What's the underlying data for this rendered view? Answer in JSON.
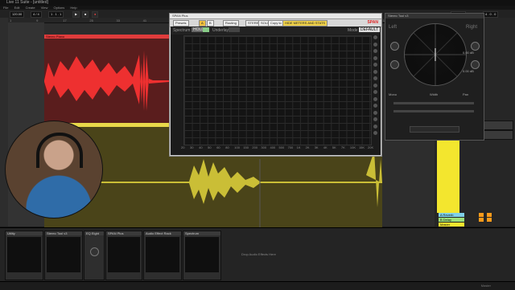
{
  "window": {
    "title": "Live 11 Suite - [untitled]"
  },
  "menu": [
    "File",
    "Edit",
    "Create",
    "View",
    "Options",
    "Help"
  ],
  "transport": {
    "tempo": "120.00",
    "signature": "4 / 4",
    "position": "1 . 1 . 1",
    "loop_start": "1 . 1 . 1",
    "loop_len": "4 . 0 . 0"
  },
  "ruler_marks": [
    "1",
    "9",
    "17",
    "25",
    "33",
    "41",
    "49",
    "57",
    "65",
    "73",
    "81",
    "89",
    "97",
    "105",
    "113",
    "121"
  ],
  "tracks": [
    {
      "name": "Stereo Piano",
      "color": "#e03c3c"
    },
    {
      "name": "Vocal Take",
      "color": "#e8d84a"
    }
  ],
  "right_tracks": [
    {
      "label": "A Reverb",
      "color": "#7fd0e8"
    },
    {
      "label": "B Delay",
      "color": "#9be07a"
    },
    {
      "label": "Master",
      "color": "#f3e62e"
    }
  ],
  "spectrum": {
    "window_title": "SPAN Plus",
    "toolbar": [
      "Presets",
      "A",
      "B",
      "Routing",
      "STEREO",
      "SOLO",
      "Copy to",
      "HIDE METERS AND STATS"
    ],
    "logo": "SPAN",
    "head_left": "Spectrum",
    "hold_label": "HOLD",
    "underlay_label": "Underlay",
    "mode_label": "Mode",
    "mode_value": "DEFAULT",
    "freq_labels": [
      "20",
      "30",
      "40",
      "50",
      "60",
      "80",
      "100",
      "150",
      "200",
      "300",
      "400",
      "500",
      "700",
      "1K",
      "2K",
      "3K",
      "4K",
      "5K",
      "7K",
      "10K",
      "15K",
      "20K"
    ]
  },
  "stereo": {
    "window_title": "Stereo Tool v3",
    "left": "Left",
    "right": "Right",
    "readouts": [
      "0.00 dB",
      "0.00 dB",
      "0.00 dB",
      "0.00 dB"
    ],
    "bottom_labels": [
      "Mono",
      "Width",
      "Pan"
    ]
  },
  "devices": [
    {
      "name": "Utility"
    },
    {
      "name": "Stereo Tool v3"
    },
    {
      "name": "EQ Eight"
    },
    {
      "name": "SPAN Plus"
    },
    {
      "name": "Audio Effect Rack"
    },
    {
      "name": "Spectrum"
    }
  ],
  "drop_hint": "Drop Audio Effects Here",
  "status": {
    "right": "Master"
  }
}
